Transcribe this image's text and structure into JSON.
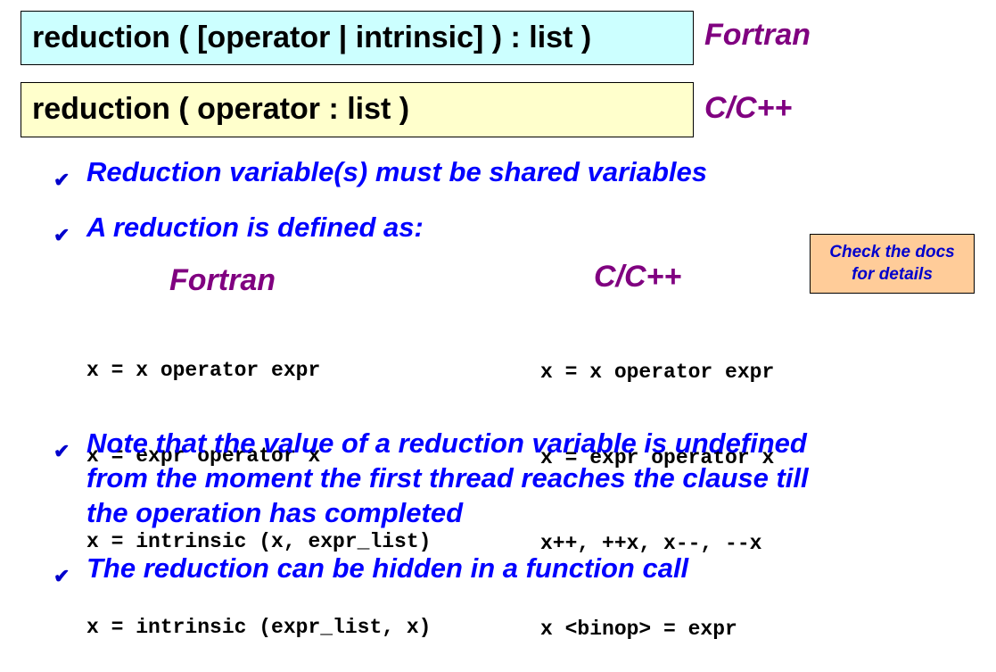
{
  "syntax": {
    "fortran_box": "reduction ( [operator | intrinsic] ) : list )",
    "fortran_label": "Fortran",
    "c_box": "reduction ( operator : list )",
    "c_label": "C/C++"
  },
  "bullets": {
    "b1": "Reduction variable(s) must be shared variables",
    "b2": "A reduction is defined as:",
    "b3": [
      "Note that the value of a reduction variable is undefined",
      "from the moment the first thread reaches the clause till",
      "the operation has completed"
    ],
    "b4": "The reduction can be hidden in a function call",
    "check_glyph": "✔"
  },
  "forms": {
    "fortran_heading": "Fortran",
    "fortran_lines": [
      "x = x operator expr",
      "x = expr operator x",
      "x = intrinsic (x, expr_list)",
      "x = intrinsic (expr_list, x)"
    ],
    "c_heading": "C/C++",
    "c_lines": [
      "x = x operator expr",
      "x = expr operator x",
      "x++, ++x, x--, --x",
      "x <binop> = expr"
    ]
  },
  "note": {
    "lines": [
      "Check the docs",
      "for details"
    ]
  },
  "colors": {
    "fortran_box_bg": "#ccffff",
    "c_box_bg": "#ffffcc",
    "language_label": "#800080",
    "bullet_text": "#0000ff",
    "note_bg": "#ffcc99"
  }
}
